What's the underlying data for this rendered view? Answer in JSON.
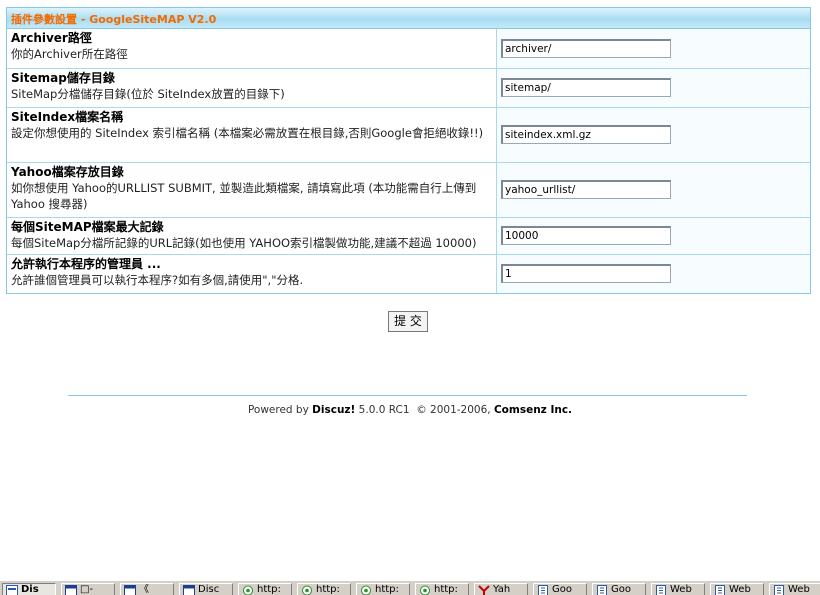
{
  "panel": {
    "title": "插件參數設置 - GoogleSiteMAP V2.0"
  },
  "settings": [
    {
      "title": "Archiver路徑",
      "desc": "你的Archiver所在路徑",
      "value": "archiver/"
    },
    {
      "title": "Sitemap儲存目錄",
      "desc": "SiteMap分檔儲存目錄(位於 SiteIndex放置的目錄下)",
      "value": "sitemap/"
    },
    {
      "title": "SiteIndex檔案名稱",
      "desc": "設定你想使用的 SiteIndex 索引檔名稱 (本檔案必需放置在根目錄,否則Google會拒絕收錄!!)",
      "value": "siteindex.xml.gz"
    },
    {
      "title": "Yahoo檔案存放目錄",
      "desc": "如你想使用 Yahoo的URLLIST SUBMIT, 並製造此類檔案, 請填寫此項 (本功能需自行上傳到 Yahoo 搜尋器)",
      "value": "yahoo_urllist/"
    },
    {
      "title": "每個SiteMAP檔案最大記錄",
      "desc": "每個SiteMap分檔所記錄的URL記錄(如也使用 YAHOO索引檔製做功能,建議不超過 10000)",
      "value": "10000"
    },
    {
      "title": "允許執行本程序的管理員 ...",
      "desc": "允許誰個管理員可以執行本程序?如有多個,請使用\",\"分格.",
      "value": "1"
    }
  ],
  "submit_label": "提 交",
  "footer": {
    "powered_by": "Powered by",
    "product": "Discuz!",
    "version": "5.0.0 RC1",
    "copyright": "© 2001-2006,",
    "company": "Comsenz Inc."
  },
  "taskbar": [
    {
      "label": "Dis",
      "icon": "discuz-icon",
      "active": true
    },
    {
      "label": "□-",
      "icon": "window-icon",
      "active": false
    },
    {
      "label": "《",
      "icon": "window-icon",
      "active": false
    },
    {
      "label": "Disc",
      "icon": "window-icon",
      "active": false
    },
    {
      "label": "http:",
      "icon": "browser-icon",
      "active": false
    },
    {
      "label": "http:",
      "icon": "browser-icon",
      "active": false
    },
    {
      "label": "http:",
      "icon": "browser-icon",
      "active": false
    },
    {
      "label": "http:",
      "icon": "browser-icon",
      "active": false
    },
    {
      "label": "Yah",
      "icon": "yahoo-icon",
      "active": false
    },
    {
      "label": "Goo",
      "icon": "page-icon",
      "active": false
    },
    {
      "label": "Goo",
      "icon": "page-icon",
      "active": false
    },
    {
      "label": "Web",
      "icon": "page-icon",
      "active": false
    },
    {
      "label": "Web",
      "icon": "page-icon",
      "active": false
    },
    {
      "label": "Web",
      "icon": "page-icon",
      "active": false
    }
  ]
}
